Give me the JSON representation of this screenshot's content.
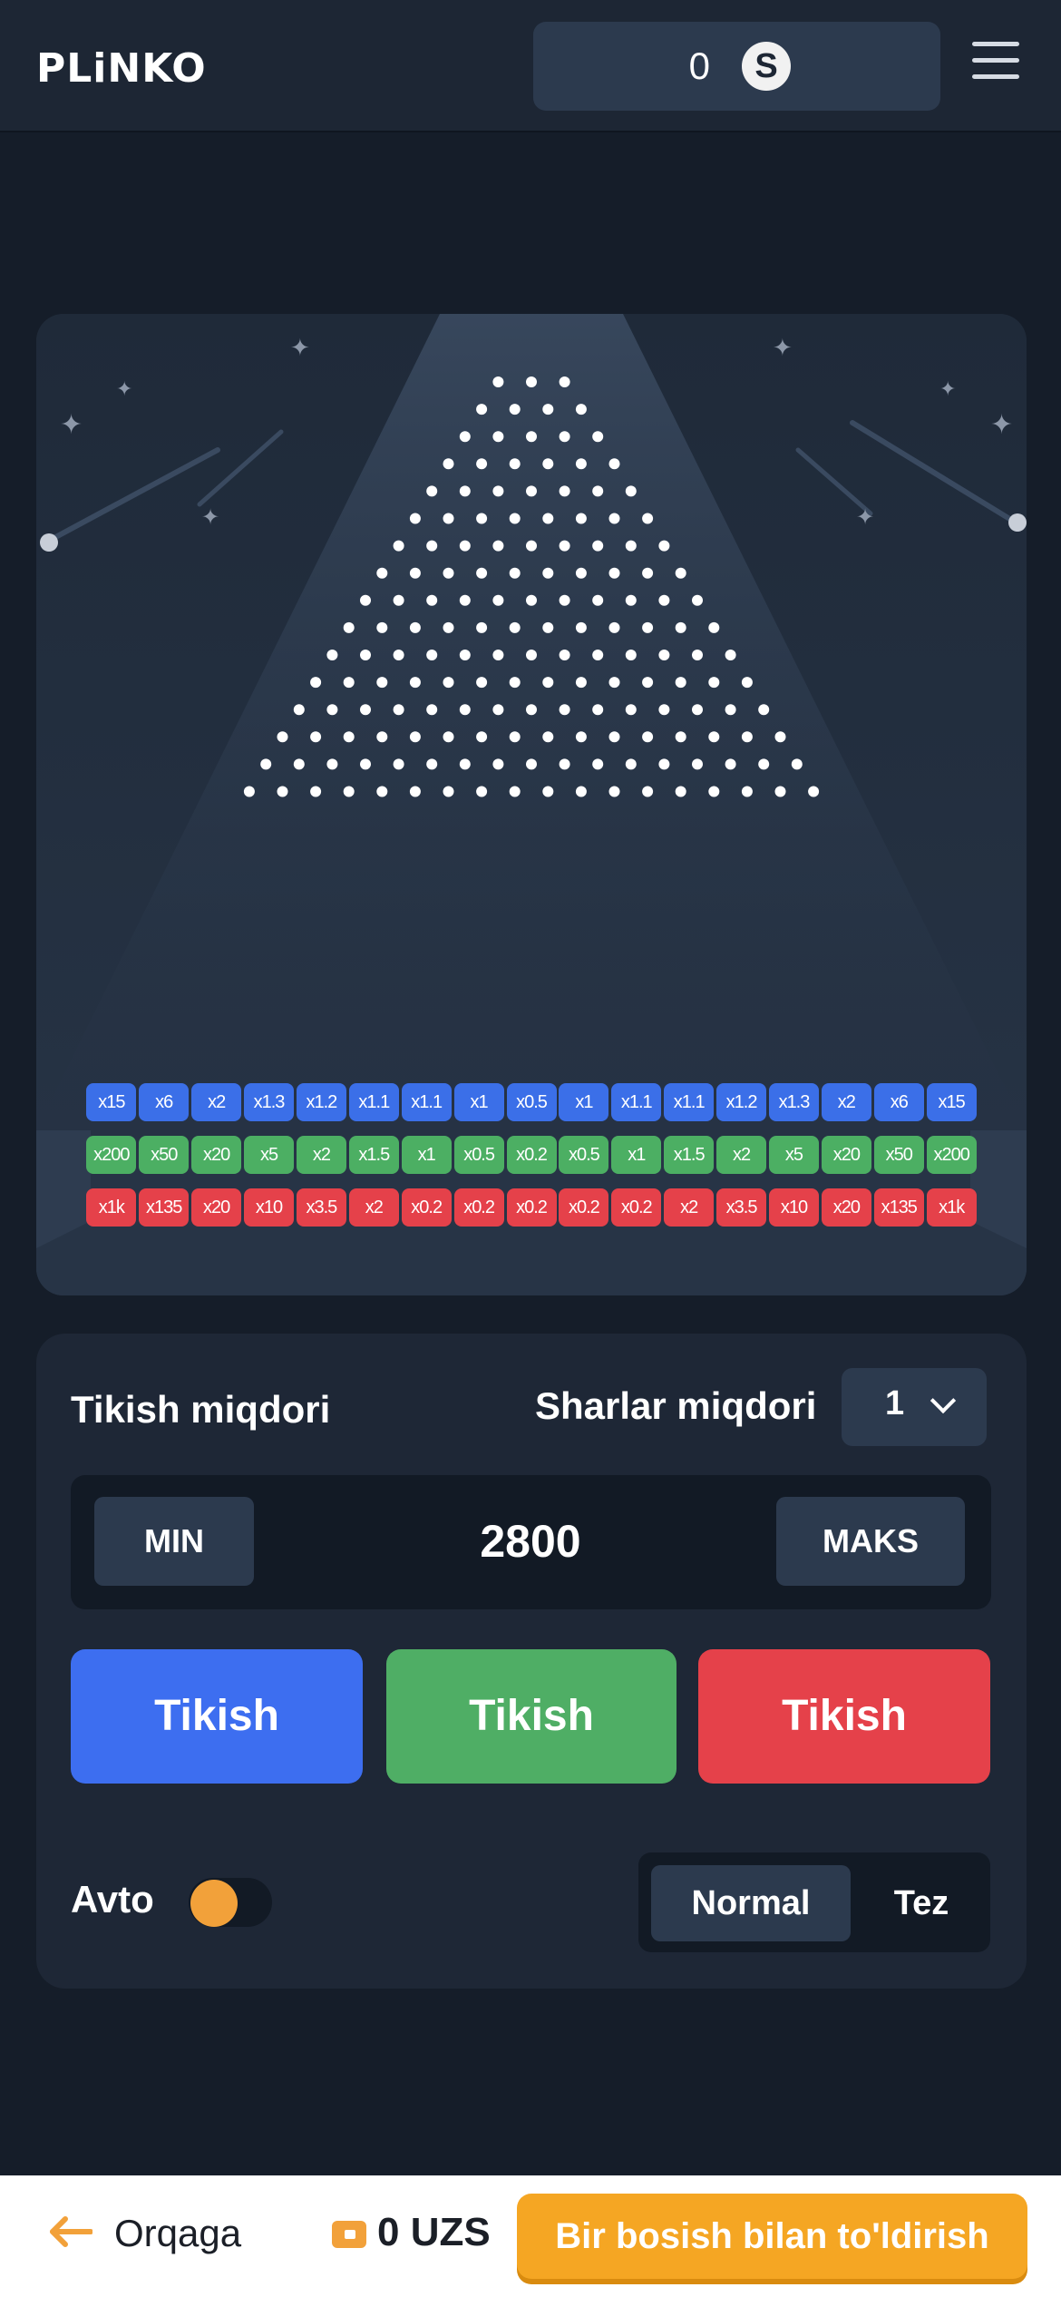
{
  "header": {
    "logo": "PLiNKO",
    "balance": "0",
    "coin_symbol": "S"
  },
  "board": {
    "rows": 16,
    "multipliers_blue": [
      "x15",
      "x6",
      "x2",
      "x1.3",
      "x1.2",
      "x1.1",
      "x1.1",
      "x1",
      "x0.5",
      "x1",
      "x1.1",
      "x1.1",
      "x1.2",
      "x1.3",
      "x2",
      "x6",
      "x15"
    ],
    "multipliers_green": [
      "x200",
      "x50",
      "x20",
      "x5",
      "x2",
      "x1.5",
      "x1",
      "x0.5",
      "x0.2",
      "x0.5",
      "x1",
      "x1.5",
      "x2",
      "x5",
      "x20",
      "x50",
      "x200"
    ],
    "multipliers_red": [
      "x1k",
      "x135",
      "x20",
      "x10",
      "x3.5",
      "x2",
      "x0.2",
      "x0.2",
      "x0.2",
      "x0.2",
      "x0.2",
      "x2",
      "x3.5",
      "x10",
      "x20",
      "x135",
      "x1k"
    ],
    "colors": {
      "blue": "#3b6fe8",
      "green": "#4caf63",
      "red": "#e5414a",
      "peg": "#ffffff"
    }
  },
  "controls": {
    "bet_label": "Tikish miqdori",
    "balls_label": "Sharlar miqdori",
    "balls_value": "1",
    "min_label": "MIN",
    "amount": "2800",
    "max_label": "MAKS",
    "bet_buttons": [
      "Tikish",
      "Tikish",
      "Tikish"
    ],
    "bet_colors": [
      "#3d6ef0",
      "#4fae65",
      "#e5414a"
    ],
    "auto_label": "Avto",
    "speed_options": [
      "Normal",
      "Tez"
    ]
  },
  "bottom_bar": {
    "back_label": "Orqaga",
    "wallet_label": "0 UZS",
    "topup_label": "Bir bosish bilan to'ldirish"
  }
}
